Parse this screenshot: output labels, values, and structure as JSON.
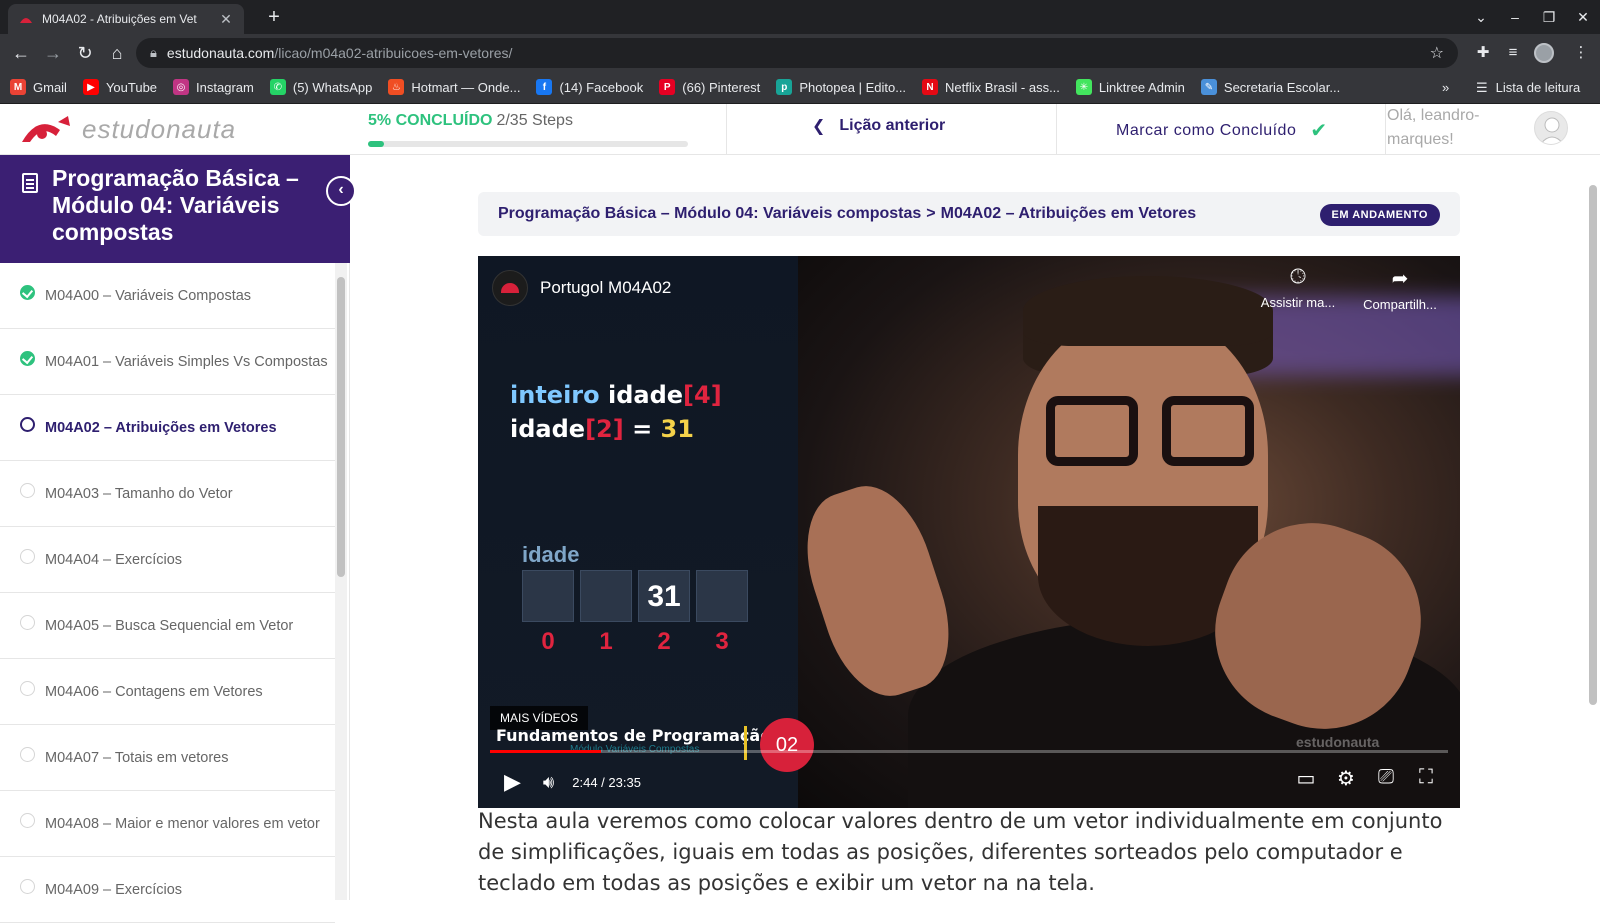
{
  "browser": {
    "tab_title": "M04A02 - Atribuições em Vet",
    "url_domain": "estudonauta.com",
    "url_path": "/licao/m04a02-atribuicoes-em-vetores/",
    "bookmarks": [
      {
        "label": "Gmail",
        "icon": "gmail-icon",
        "color": "#ea4335"
      },
      {
        "label": "YouTube",
        "icon": "youtube-icon",
        "color": "#ff0000"
      },
      {
        "label": "Instagram",
        "icon": "instagram-icon",
        "color": "#c13584"
      },
      {
        "label": "(5) WhatsApp",
        "icon": "whatsapp-icon",
        "color": "#25d366"
      },
      {
        "label": "Hotmart — Onde...",
        "icon": "hotmart-icon",
        "color": "#f04e23"
      },
      {
        "label": "(14) Facebook",
        "icon": "facebook-icon",
        "color": "#1877f2"
      },
      {
        "label": "(66) Pinterest",
        "icon": "pinterest-icon",
        "color": "#e60023"
      },
      {
        "label": "Photopea | Edito...",
        "icon": "photopea-icon",
        "color": "#18a497"
      },
      {
        "label": "Netflix Brasil - ass...",
        "icon": "netflix-icon",
        "color": "#e50914"
      },
      {
        "label": "Linktree Admin",
        "icon": "linktree-icon",
        "color": "#43e55e"
      },
      {
        "label": "Secretaria Escolar...",
        "icon": "secretaria-icon",
        "color": "#4a90d9"
      }
    ],
    "bookmarks_more": "»",
    "reading_list": "Lista de leitura"
  },
  "header": {
    "logo_text": "estudonauta",
    "progress_percent_label": "5% CONCLUÍDO",
    "progress_steps": "2/35 Steps",
    "progress_fraction": 0.05,
    "prev_lesson": "Lição anterior",
    "mark_complete": "Marcar como Concluído",
    "greeting_line1": "Olá, leandro-",
    "greeting_line2": "marques!"
  },
  "sidebar": {
    "course_title": "Programação Básica – Módulo 04: Variáveis compostas",
    "lessons": [
      {
        "label": "M04A00 – Variáveis Compostas",
        "status": "done"
      },
      {
        "label": "M04A01 – Variáveis Simples Vs Compostas",
        "status": "done"
      },
      {
        "label": "M04A02 – Atribuições em Vetores",
        "status": "current"
      },
      {
        "label": "M04A03 – Tamanho do Vetor",
        "status": "todo"
      },
      {
        "label": "M04A04 – Exercícios",
        "status": "todo"
      },
      {
        "label": "M04A05 – Busca Sequencial em Vetor",
        "status": "todo"
      },
      {
        "label": "M04A06 – Contagens em Vetores",
        "status": "todo"
      },
      {
        "label": "M04A07 – Totais em vetores",
        "status": "todo"
      },
      {
        "label": "M04A08 – Maior e menor valores em vetor",
        "status": "todo"
      },
      {
        "label": "M04A09 – Exercícios",
        "status": "todo"
      }
    ]
  },
  "breadcrumb": {
    "course": "Programação Básica – Módulo 04: Variáveis compostas",
    "separator": ">",
    "lesson": "M04A02 – Atribuições em Vetores",
    "badge": "EM ANDAMENTO"
  },
  "video": {
    "title": "Portugol M04A02",
    "watch_later": "Assistir ma...",
    "share": "Compartilh...",
    "code_kw": "inteiro",
    "code_var": "idade",
    "code_size": "4",
    "code_idx": "2",
    "code_eq": "=",
    "code_val": "31",
    "array_label": "idade",
    "cells": [
      "",
      "",
      "31",
      ""
    ],
    "indices": [
      "0",
      "1",
      "2",
      "3"
    ],
    "more_videos": "MAIS VÍDEOS",
    "series_title": "Fundamentos de Programação",
    "series_sub": "Módulo Variáveis Compostas",
    "episode": "02",
    "watermark": "estudonauta",
    "time": "2:44 / 23:35",
    "progress_fraction": 0.116
  },
  "description": "Nesta aula veremos como colocar valores dentro de um vetor individualmente em conjunto de simplificações, iguais em todas as posições, diferentes sorteados pelo computador e teclado em todas as posições e exibir um vetor na na tela."
}
